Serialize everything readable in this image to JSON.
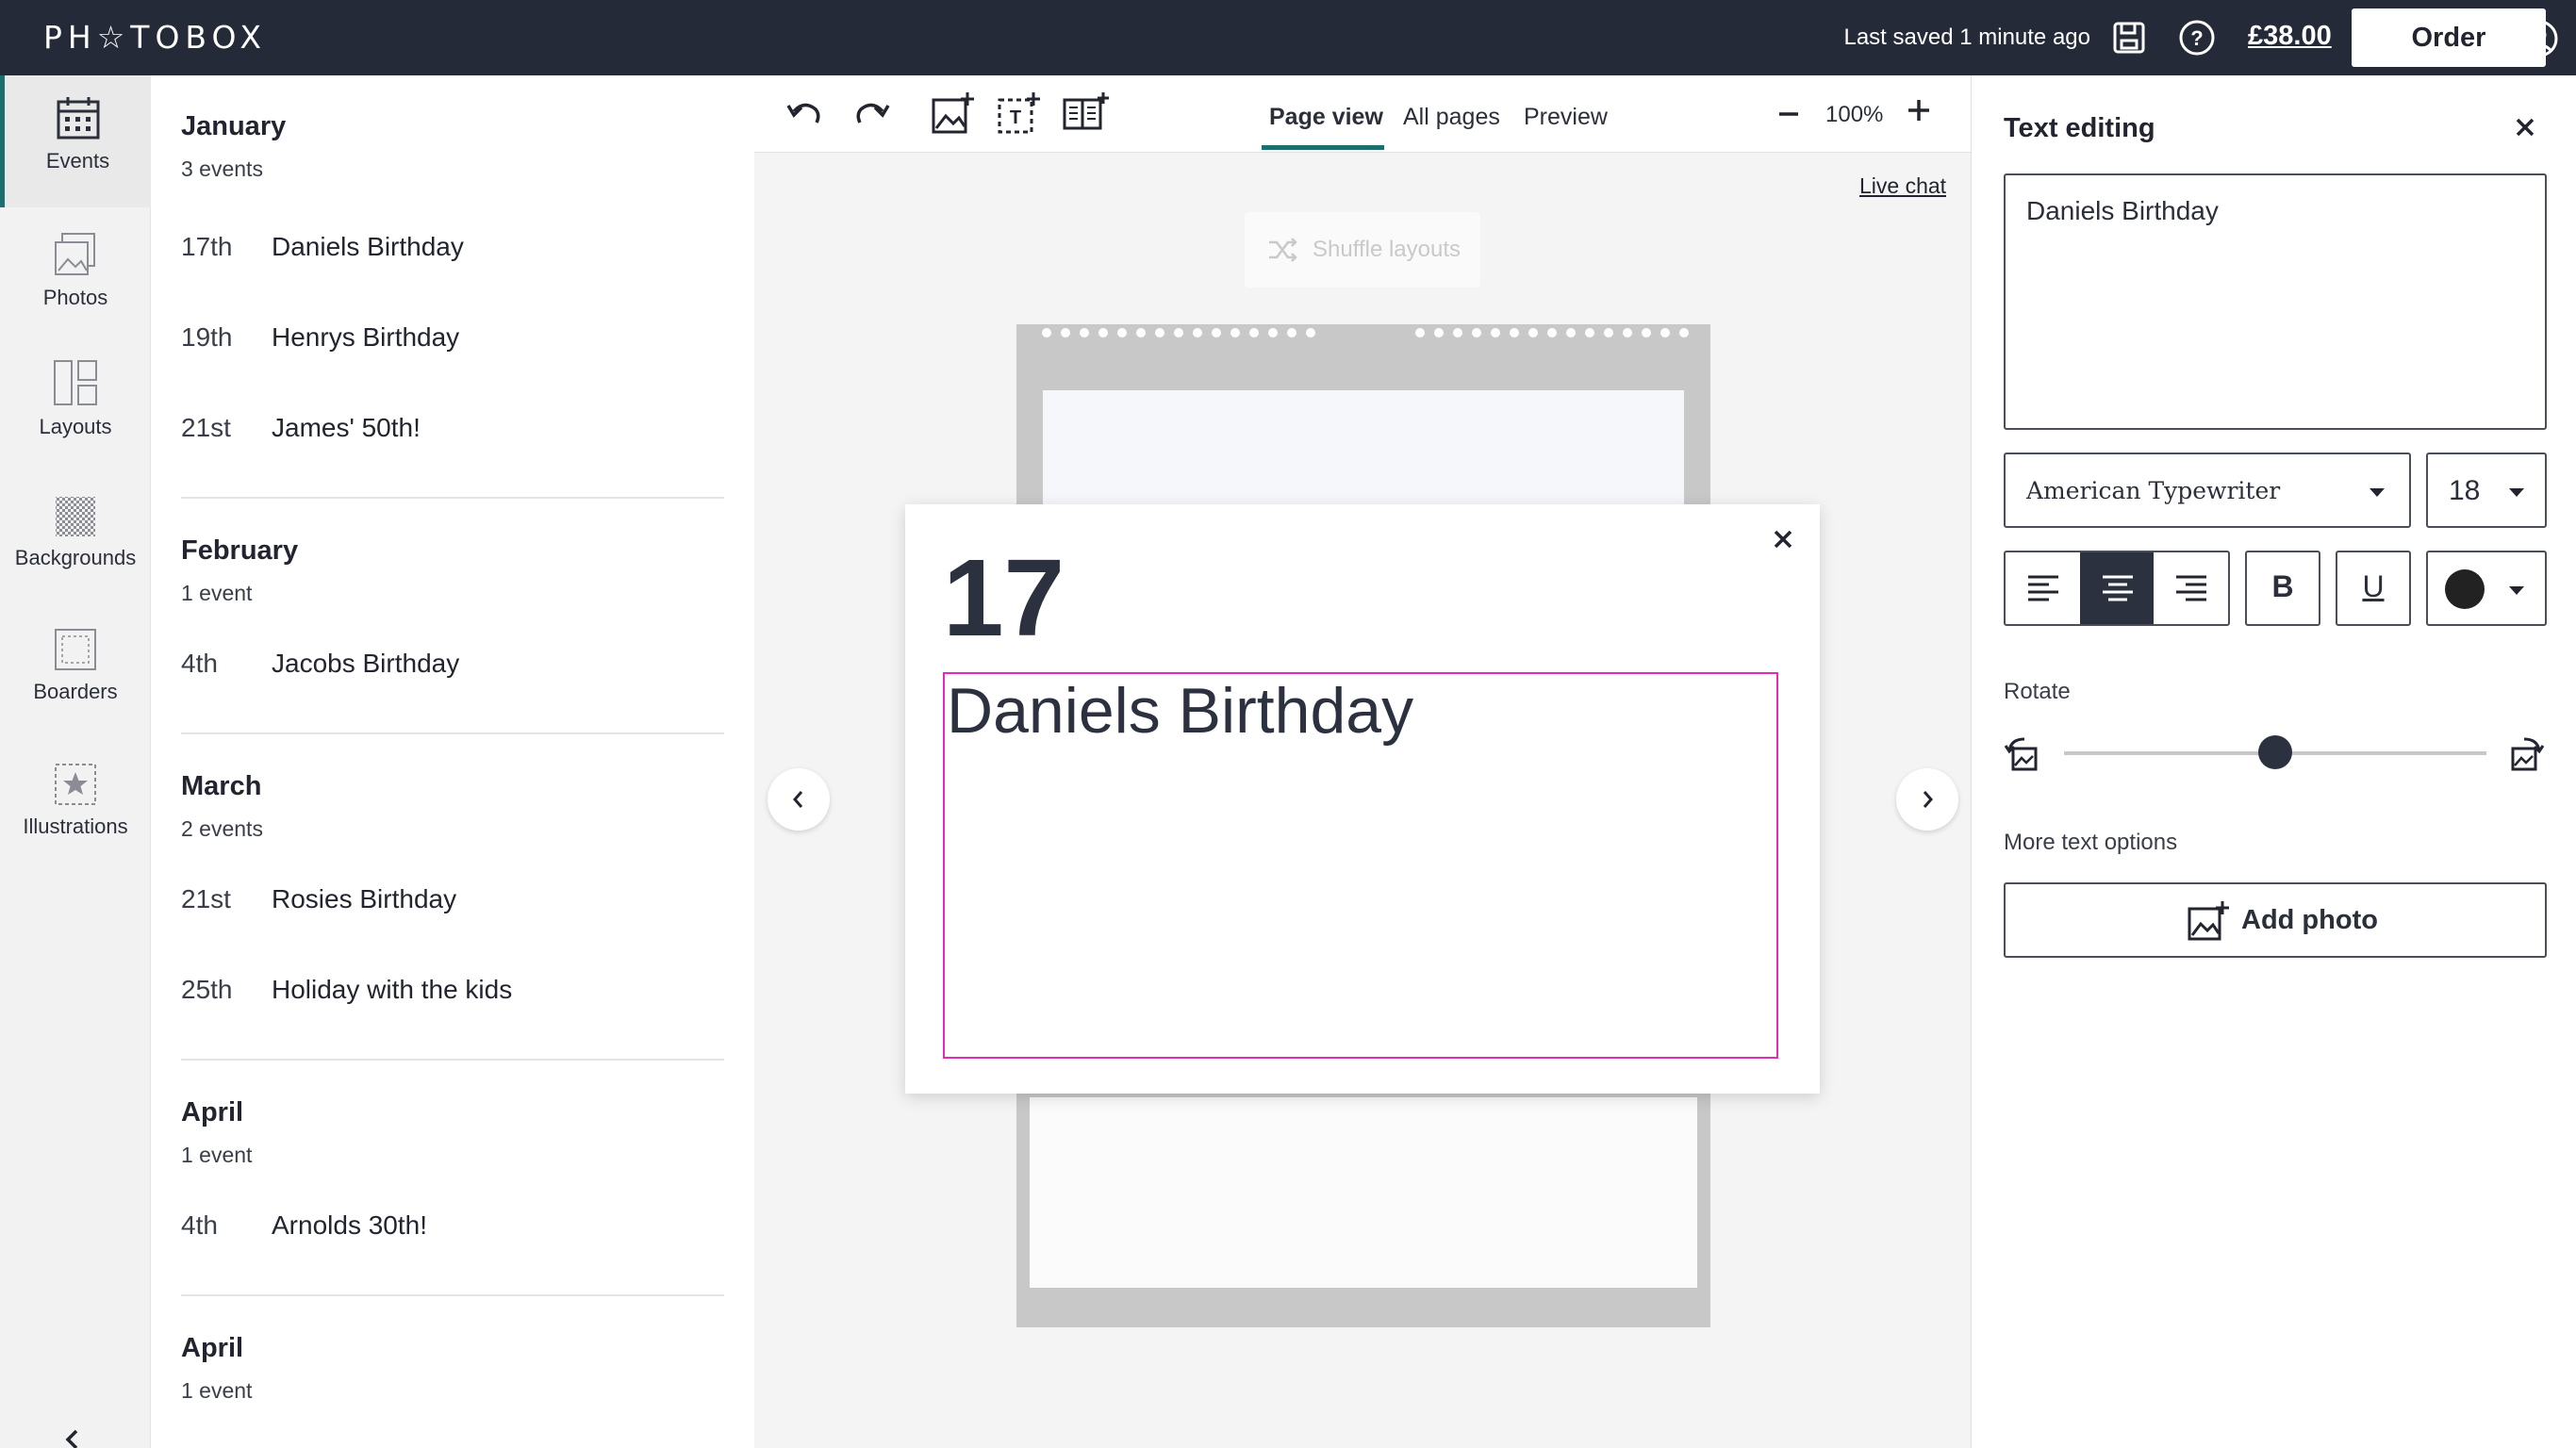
{
  "app": {
    "logo": "PH☆TOBOX"
  },
  "topbar": {
    "saved_status": "Last saved 1 minute ago",
    "price": "£38.00",
    "order_label": "Order"
  },
  "rail": {
    "items": [
      {
        "label": "Events",
        "icon": "calendar-icon",
        "active": true
      },
      {
        "label": "Photos",
        "icon": "photos-icon"
      },
      {
        "label": "Layouts",
        "icon": "layouts-icon"
      },
      {
        "label": "Backgrounds",
        "icon": "backgrounds-icon"
      },
      {
        "label": "Boarders",
        "icon": "borders-icon"
      },
      {
        "label": "Illustrations",
        "icon": "illustrations-icon"
      }
    ]
  },
  "events": {
    "groups": [
      {
        "month": "January",
        "count": "3 events",
        "items": [
          {
            "date": "17th",
            "name": "Daniels Birthday"
          },
          {
            "date": "19th",
            "name": "Henrys Birthday"
          },
          {
            "date": "21st",
            "name": "James' 50th!"
          }
        ]
      },
      {
        "month": "February",
        "count": "1 event",
        "items": [
          {
            "date": "4th",
            "name": "Jacobs Birthday"
          }
        ]
      },
      {
        "month": "March",
        "count": "2 events",
        "items": [
          {
            "date": "21st",
            "name": "Rosies Birthday"
          },
          {
            "date": "25th",
            "name": "Holiday with the kids"
          }
        ]
      },
      {
        "month": "April",
        "count": "1 event",
        "items": [
          {
            "date": "4th",
            "name": "Arnolds 30th!"
          }
        ]
      },
      {
        "month": "April",
        "count": "1 event",
        "items": []
      }
    ]
  },
  "toolbar": {
    "tabs": [
      {
        "label": "Page view",
        "active": true
      },
      {
        "label": "All pages"
      },
      {
        "label": "Preview"
      }
    ],
    "zoom": "100%"
  },
  "canvas": {
    "live_chat": "Live chat",
    "shuffle_label": "Shuffle layouts",
    "popup": {
      "day": "17",
      "text": "Daniels Birthday"
    }
  },
  "panel": {
    "title": "Text editing",
    "text_value": "Daniels Birthday",
    "font": "American Typewriter",
    "size": "18",
    "bold": "B",
    "underline": "U",
    "text_color": "#222222",
    "rotate_label": "Rotate",
    "rotate_value": 0.5,
    "more_options": "More text options",
    "add_photo": "Add photo"
  },
  "colors": {
    "topbar": "#242a38",
    "accent": "#1b6f6f",
    "selection": "#e22bbd"
  }
}
